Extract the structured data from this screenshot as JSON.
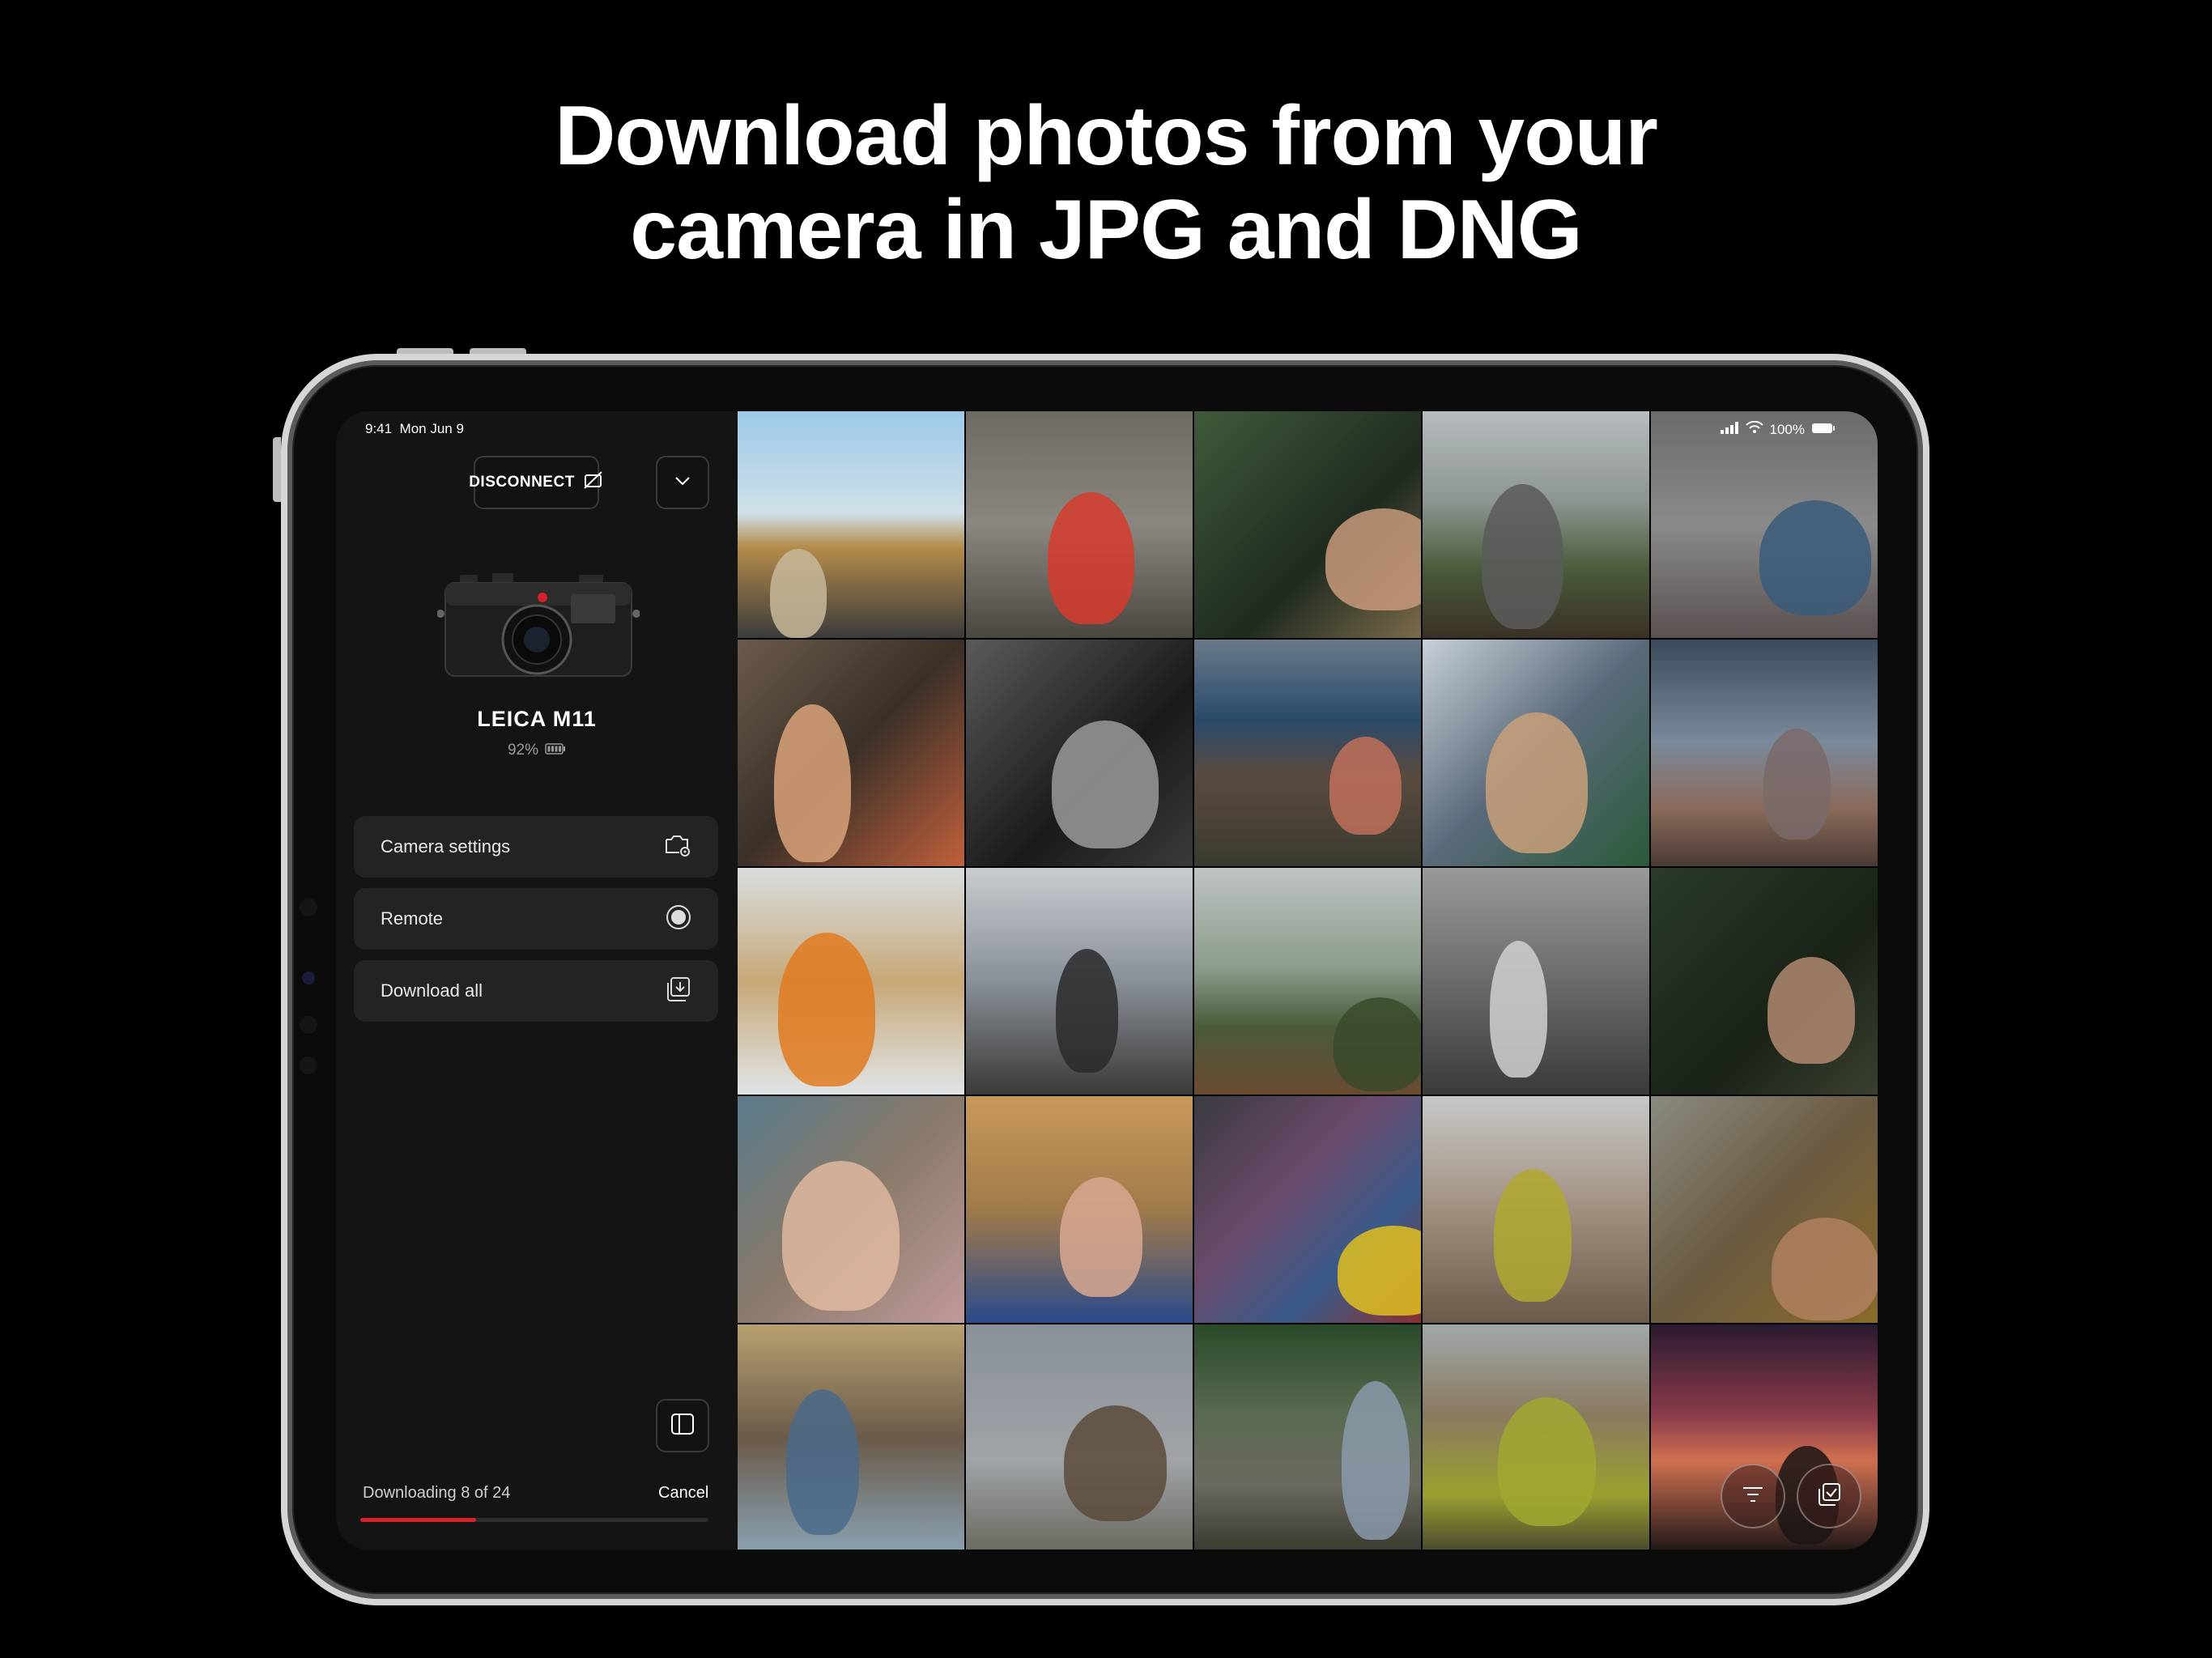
{
  "headline": {
    "line1": "Download photos from your",
    "line2": "camera in JPG and DNG"
  },
  "status_bar": {
    "time": "9:41",
    "date": "Mon Jun 9",
    "battery": "100%"
  },
  "sidebar": {
    "disconnect_label": "DISCONNECT",
    "camera_name": "LEICA M11",
    "camera_battery": "92%",
    "menu": [
      {
        "label": "Camera settings",
        "icon": "camera-settings-icon"
      },
      {
        "label": "Remote",
        "icon": "shutter-icon"
      },
      {
        "label": "Download all",
        "icon": "download-all-icon"
      }
    ],
    "download": {
      "status": "Downloading 8 of 24",
      "cancel_label": "Cancel",
      "progress": 0.333
    }
  },
  "accent_color": "#d8202a",
  "photos": [
    {
      "bg": "linear-gradient(180deg,#9cc9e8 0%,#cfe0e8 45%,#b48b4a 60%,#3b3b3b 100%)",
      "fg": "#c7b89a"
    },
    {
      "bg": "linear-gradient(180deg,#6d6a64 0%,#8a8780 50%,#4a4640 100%)",
      "fg": "#d63b2d"
    },
    {
      "bg": "linear-gradient(135deg,#3f5a3a 0%,#1f2a20 60%,#7a6a4a 100%)",
      "fg": "#c89a7a"
    },
    {
      "bg": "linear-gradient(180deg,#b7bcc0 0%,#8d9590 40%,#4a5a3a 70%,#3a3025 100%)",
      "fg": "#5a5a5a"
    },
    {
      "bg": "linear-gradient(180deg,#6b6b6b 0%,#8a8a8a 50%,#5a5050 100%)",
      "fg": "#3a5a7a"
    },
    {
      "bg": "linear-gradient(135deg,#6a5a4a 0%,#3a3028 50%,#c0603a 100%)",
      "fg": "#d9a27a"
    },
    {
      "bg": "linear-gradient(135deg,#5a5a5a 0%,#1a1a1a 60%,#3a3a3a 100%)",
      "fg": "#9a9a9a"
    },
    {
      "bg": "linear-gradient(180deg,#6a7a8a 0%,#2a4a6a 35%,#5a4a40 60%,#3a3a30 100%)",
      "fg": "#c0705a"
    },
    {
      "bg": "linear-gradient(135deg,#c8d0d8 0%,#5a6a7a 50%,#2a5a3a 100%)",
      "fg": "#c9a07a"
    },
    {
      "bg": "linear-gradient(180deg,#3a4a5a 0%,#7a8a9a 45%,#8a6a5a 75%,#4a3a35 100%)",
      "fg": "#7a6a6a"
    },
    {
      "bg": "linear-gradient(180deg,#d8dde0 0%,#c8a878 50%,#e0e4e6 100%)",
      "fg": "#e07a20"
    },
    {
      "bg": "linear-gradient(180deg,#c8ccd0 0%,#8a9098 50%,#3a3a38 100%)",
      "fg": "#2a2a2a"
    },
    {
      "bg": "linear-gradient(180deg,#c0c4c4 0%,#8a9a8a 45%,#4a5a3a 70%,#6a4a30 100%)",
      "fg": "#3a4a2a"
    },
    {
      "bg": "linear-gradient(180deg,#9a9a9a 0%,#6a6a6a 50%,#3a3a3a 100%)",
      "fg": "#d0d0d0"
    },
    {
      "bg": "linear-gradient(135deg,#2a3a2a 0%,#1a2218 60%,#3a4030 100%)",
      "fg": "#b08a70"
    },
    {
      "bg": "linear-gradient(135deg,#5a7a8a 0%,#8a7a6a 50%,#c09a9a 100%)",
      "fg": "#e0b8a0"
    },
    {
      "bg": "linear-gradient(180deg,#c89a5a 0%,#a07a4a 50%,#2a4a8a 100%)",
      "fg": "#d8a890"
    },
    {
      "bg": "linear-gradient(135deg,#3a3a40 0%,#6a4a6a 40%,#3a5a8a 70%,#8a3030 100%)",
      "fg": "#e0c020"
    },
    {
      "bg": "linear-gradient(180deg,#c8c8c8 0%,#a09080 50%,#6a5a4a 100%)",
      "fg": "#b0a830"
    },
    {
      "bg": "linear-gradient(135deg,#8a8a80 0%,#6a5a40 50%,#8a6a2a 100%)",
      "fg": "#b08060"
    },
    {
      "bg": "linear-gradient(180deg,#b8a070 0%,#6a5a4a 50%,#8aa0b0 100%)",
      "fg": "#4a6a8a"
    },
    {
      "bg": "linear-gradient(180deg,#8a9098 0%,#a0a4a8 60%,#6a6a60 100%)",
      "fg": "#5a4a3a"
    },
    {
      "bg": "linear-gradient(180deg,#2a4a2a 0%,#5a6a50 40%,#6a6a60 70%,#3a3a30 100%)",
      "fg": "#8a9aaa"
    },
    {
      "bg": "linear-gradient(180deg,#a0a8a8 0%,#8a7a60 40%,#9aa030 75%,#4a4a30 100%)",
      "fg": "#a0a830"
    },
    {
      "bg": "linear-gradient(180deg,#2a1a30 0%,#8a3a4a 40%,#d07050 60%,#201818 100%)",
      "fg": "#1a1515"
    }
  ]
}
